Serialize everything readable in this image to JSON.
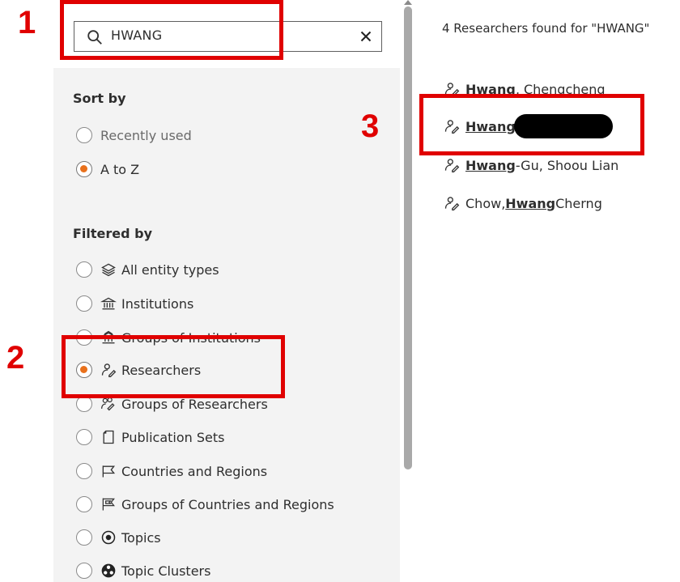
{
  "search": {
    "value": "HWANG"
  },
  "sort": {
    "title": "Sort by",
    "options": [
      {
        "label": "Recently used",
        "checked": false
      },
      {
        "label": "A to Z",
        "checked": true
      }
    ]
  },
  "filter": {
    "title": "Filtered by",
    "options": [
      {
        "label": "All entity types",
        "icon": "layers-icon",
        "checked": false
      },
      {
        "label": "Institutions",
        "icon": "institution-icon",
        "checked": false
      },
      {
        "label": "Groups of Institutions",
        "icon": "institution-group-icon",
        "checked": false
      },
      {
        "label": "Researchers",
        "icon": "researcher-icon",
        "checked": true
      },
      {
        "label": "Groups of Researchers",
        "icon": "researcher-group-icon",
        "checked": false
      },
      {
        "label": "Publication Sets",
        "icon": "publication-set-icon",
        "checked": false
      },
      {
        "label": "Countries and Regions",
        "icon": "flag-icon",
        "checked": false
      },
      {
        "label": "Groups of Countries and Regions",
        "icon": "flag-group-icon",
        "checked": false
      },
      {
        "label": "Topics",
        "icon": "topic-icon",
        "checked": false
      },
      {
        "label": "Topic Clusters",
        "icon": "topic-cluster-icon",
        "checked": false
      }
    ]
  },
  "results": {
    "count_text": "4 Researchers found for \"HWANG\"",
    "items": [
      {
        "pre": "",
        "match": "Hwang",
        "post": ", Chengcheng"
      },
      {
        "pre": "",
        "match": "Hwang",
        "post": ""
      },
      {
        "pre": "",
        "match": "Hwang",
        "post": "-Gu, Shoou Lian"
      },
      {
        "pre": "Chow, ",
        "match": "Hwang",
        "post": " Cherng"
      }
    ]
  },
  "annotations": [
    "1",
    "2",
    "3"
  ],
  "colors": {
    "accent": "#e9711c",
    "annotation": "#e00000",
    "panel": "#f3f3f3"
  }
}
